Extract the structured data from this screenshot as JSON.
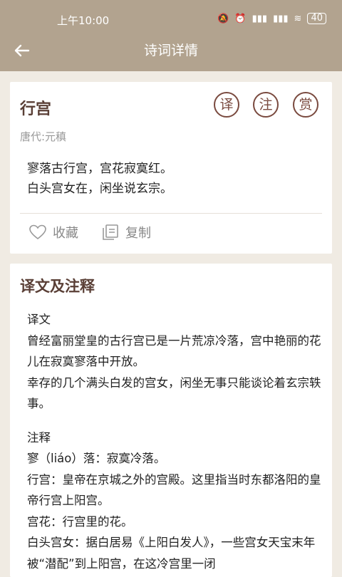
{
  "status_bar": {
    "time": "上午10:00",
    "battery": "40"
  },
  "nav": {
    "title": "诗词详情"
  },
  "poem": {
    "title": "行宫",
    "dynasty": "唐代:元稹",
    "lines": [
      "寥落古行宫，宫花寂寞红。",
      "白头宫女在，闲坐说玄宗。"
    ],
    "buttons": {
      "yi": "译",
      "zhu": "注",
      "shang": "赏"
    },
    "actions": {
      "favorite": "收藏",
      "copy": "复制"
    }
  },
  "translation": {
    "heading": "译文及注释",
    "yiwen_label": "译文",
    "yiwen_lines": [
      "曾经富丽堂皇的古行宫已是一片荒凉冷落，宫中艳丽的花儿在寂寞寥落中开放。",
      "幸存的几个满头白发的宫女，闲坐无事只能谈论着玄宗轶事。"
    ],
    "zhushi_label": "注释",
    "zhushi_lines": [
      "寥（liáo）落：寂寞冷落。",
      "行宫：皇帝在京城之外的宫殿。这里指当时东都洛阳的皇帝行宫上阳宫。",
      "宫花：行宫里的花。",
      "白头宫女：据白居易《上阳白发人》，一些宫女天宝末年被“潜配”到上阳宫，在这冷宫里一闭"
    ]
  }
}
